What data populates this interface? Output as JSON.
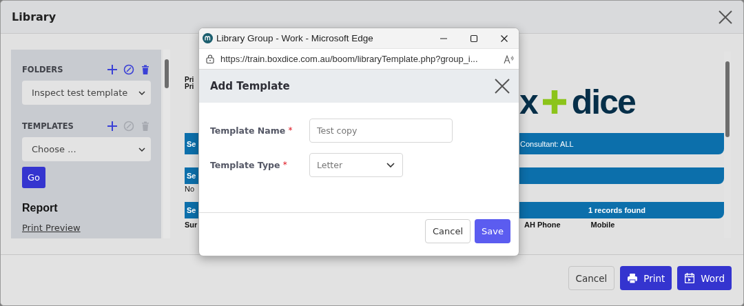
{
  "window": {
    "title": "Library"
  },
  "sidebar": {
    "sections": [
      {
        "label": "FOLDERS",
        "value": "Inspect test template",
        "actions": [
          {
            "kind": "add",
            "disabled": false
          },
          {
            "kind": "edit",
            "disabled": false
          },
          {
            "kind": "delete",
            "disabled": false
          }
        ]
      },
      {
        "label": "TEMPLATES",
        "value": "Choose ...",
        "actions": [
          {
            "kind": "add",
            "disabled": false
          },
          {
            "kind": "edit",
            "disabled": true
          },
          {
            "kind": "delete",
            "disabled": true
          }
        ]
      }
    ],
    "go_button": "Go",
    "report": {
      "heading": "Report",
      "links": [
        "Print Preview"
      ]
    }
  },
  "preview": {
    "header_lines": [
      "Pri",
      "Pri"
    ],
    "logo": {
      "left": "x",
      "right": "dice"
    },
    "sections": [
      {
        "label": "Se",
        "info": "Consultant: ALL",
        "kind": "filter"
      },
      {
        "label": "Se",
        "note": "No",
        "kind": "plain"
      },
      {
        "label": "Se",
        "info": "1 records found",
        "kind": "count",
        "columns": [
          "Sur",
          "AH Phone",
          "Mobile"
        ]
      }
    ]
  },
  "browser_popup": {
    "title": "Library Group - Work - Microsoft Edge",
    "url": "https://train.boxdice.com.au/boom/libraryTemplate.php?group_i...",
    "dialog": {
      "title": "Add Template",
      "fields": [
        {
          "kind": "text",
          "label": "Template Name",
          "required_mark": "*",
          "value": "Test copy"
        },
        {
          "kind": "select",
          "label": "Template Type",
          "required_mark": "*",
          "value": "Letter"
        }
      ],
      "buttons": [
        {
          "label": "Cancel",
          "kind": "secondary"
        },
        {
          "label": "Save",
          "kind": "primary"
        }
      ]
    }
  },
  "footer_buttons": [
    {
      "label": "Cancel",
      "kind": "secondary"
    },
    {
      "label": "Print",
      "kind": "print"
    },
    {
      "label": "Word",
      "kind": "word"
    }
  ]
}
